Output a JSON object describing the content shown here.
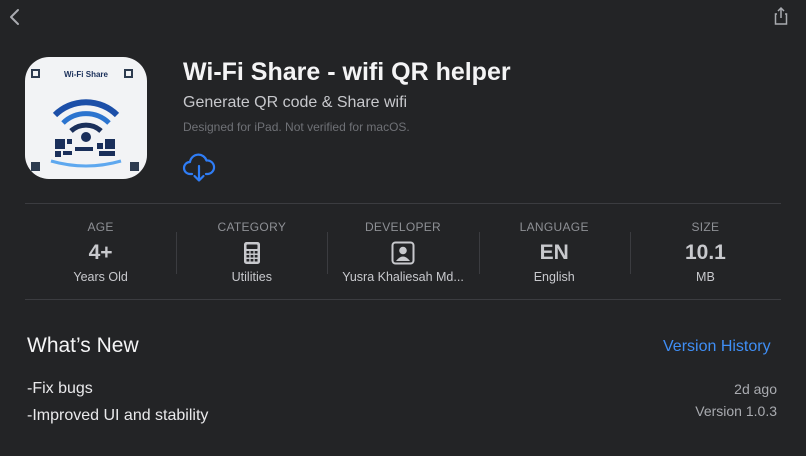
{
  "nav": {
    "back_icon": "chevron-left-icon",
    "share_icon": "share-icon"
  },
  "app": {
    "icon_caption": "Wi-Fi Share",
    "title": "Wi-Fi Share - wifi QR helper",
    "subtitle": "Generate QR code & Share wifi",
    "compat_note": "Designed for iPad. Not verified for macOS.",
    "download_icon": "cloud-download-icon"
  },
  "info": [
    {
      "label": "AGE",
      "value": "4+",
      "sub": "Years Old"
    },
    {
      "label": "CATEGORY",
      "icon": "calculator-icon",
      "sub": "Utilities"
    },
    {
      "label": "DEVELOPER",
      "icon": "person-badge-icon",
      "sub": "Yusra Khaliesah Md..."
    },
    {
      "label": "LANGUAGE",
      "value": "EN",
      "sub": "English"
    },
    {
      "label": "SIZE",
      "value": "10.1",
      "sub": "MB"
    }
  ],
  "whats_new": {
    "title": "What’s New",
    "history_link": "Version History",
    "notes": [
      "-Fix bugs",
      "-Improved UI and stability"
    ],
    "date": "2d ago",
    "version": "Version 1.0.3"
  },
  "colors": {
    "background": "#232426",
    "link": "#3f8ef5",
    "download": "#2f7df6"
  }
}
